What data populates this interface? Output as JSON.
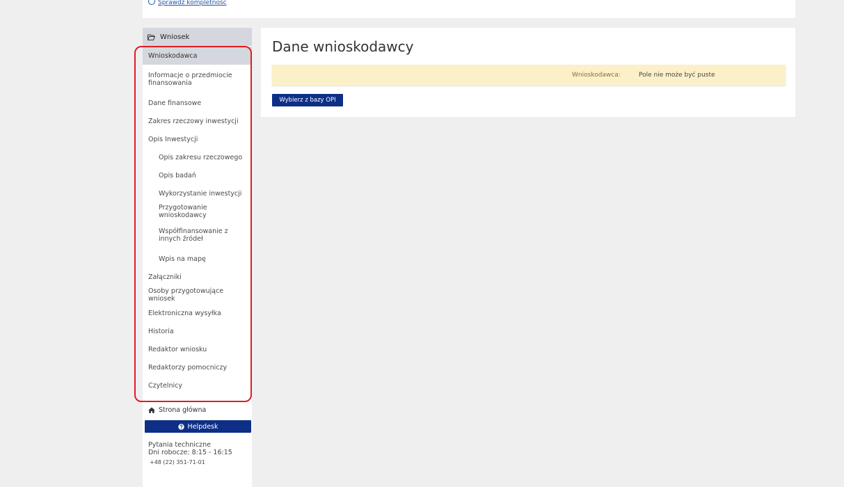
{
  "top": {
    "link_text": "Sprawdź kompletność"
  },
  "sidebar": {
    "header": "Wniosek",
    "items": [
      {
        "label": "Wnioskodawca",
        "active": true,
        "sub": false
      },
      {
        "label": "Informacje o przedmiocie finansowania",
        "active": false,
        "sub": false
      },
      {
        "label": "Dane finansowe",
        "active": false,
        "sub": false
      },
      {
        "label": "Zakres rzeczowy inwestycji",
        "active": false,
        "sub": false
      },
      {
        "label": "Opis Inwestycji",
        "active": false,
        "sub": false
      },
      {
        "label": "Opis zakresu rzeczowego",
        "active": false,
        "sub": true
      },
      {
        "label": "Opis badań",
        "active": false,
        "sub": true
      },
      {
        "label": "Wykorzystanie inwestycji",
        "active": false,
        "sub": true
      },
      {
        "label": "Przygotowanie wnioskodawcy",
        "active": false,
        "sub": true
      },
      {
        "label": "Współfinansowanie z innych źródeł",
        "active": false,
        "sub": true
      },
      {
        "label": "Wpis na mapę",
        "active": false,
        "sub": true
      },
      {
        "label": "Załączniki",
        "active": false,
        "sub": false
      },
      {
        "label": "Osoby przygotowujące wniosek",
        "active": false,
        "sub": false
      },
      {
        "label": "Elektroniczna wysyłka",
        "active": false,
        "sub": false
      },
      {
        "label": "Historia",
        "active": false,
        "sub": false
      },
      {
        "label": "Redaktor wniosku",
        "active": false,
        "sub": false
      },
      {
        "label": "Redaktorzy pomocniczy",
        "active": false,
        "sub": false
      },
      {
        "label": "Czytelnicy",
        "active": false,
        "sub": false
      }
    ],
    "home_label": "Strona główna",
    "helpdesk_label": "Helpdesk",
    "tech_title": "Pytania techniczne",
    "tech_hours": "Dni robocze: 8:15 - 16:15",
    "tech_phone": "+48 (22) 351-71-01"
  },
  "main": {
    "title": "Dane wnioskodawcy",
    "alert_field": "Wnioskodawca:",
    "alert_message": "Pole nie może być puste",
    "opi_button": "Wybierz z bazy OPI"
  },
  "colors": {
    "primary": "#0d2f86",
    "active_bg": "#d4d7dd",
    "alert_bg": "#fcf0c9",
    "highlight": "#e11b22",
    "page_bg": "#efefef"
  }
}
